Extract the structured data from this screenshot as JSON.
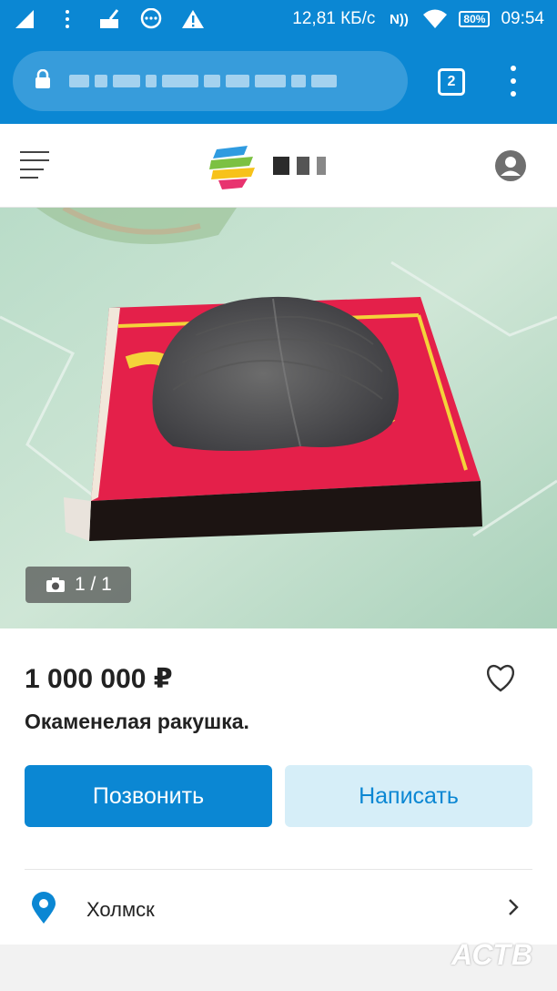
{
  "status_bar": {
    "network_speed": "12,81 КБ/с",
    "battery": "80%",
    "time": "09:54"
  },
  "browser": {
    "tab_count": "2"
  },
  "listing": {
    "photo_counter": "1 / 1",
    "price": "1 000 000 ₽",
    "title": "Окаменелая ракушка."
  },
  "actions": {
    "call_label": "Позвонить",
    "write_label": "Написать"
  },
  "location": {
    "city": "Холмск"
  },
  "watermark": "АСТВ",
  "colors": {
    "accent": "#0b87d3",
    "secondary_button_bg": "#d6eef8"
  }
}
